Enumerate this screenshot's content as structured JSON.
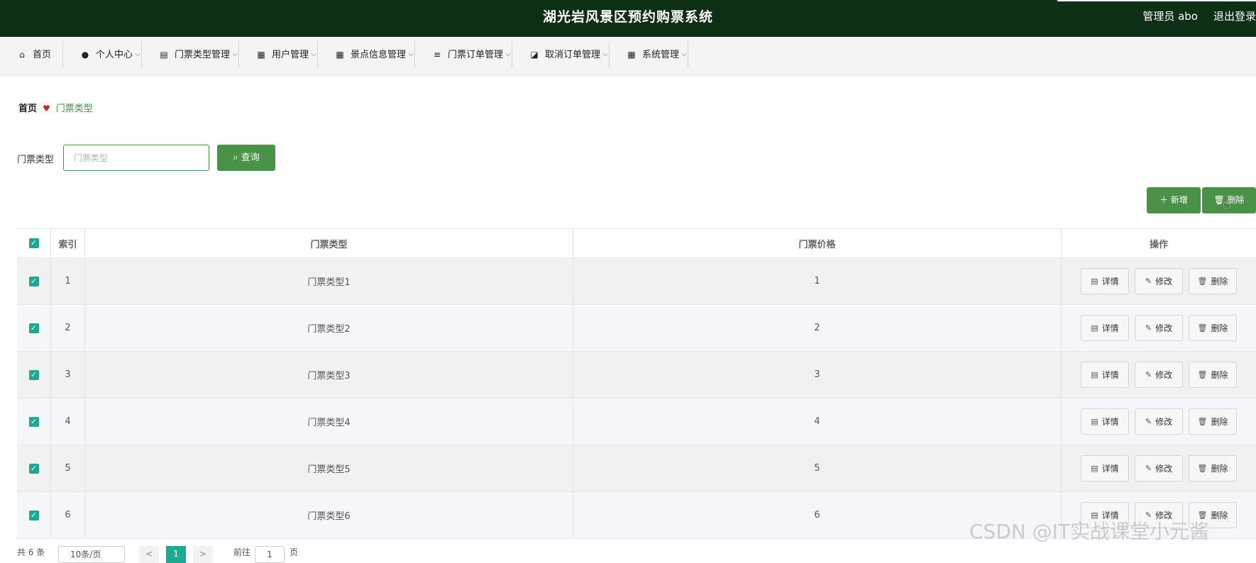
{
  "header": {
    "title": "湖光岩风景区预约购票系统",
    "user": "管理员 abo",
    "logout": "退出登录"
  },
  "nav": [
    {
      "label": "首页",
      "icon": "home-icon",
      "has_dropdown": false
    },
    {
      "label": "个人中心",
      "icon": "user-icon",
      "has_dropdown": true
    },
    {
      "label": "门票类型管理",
      "icon": "clipboard-icon",
      "has_dropdown": true
    },
    {
      "label": "用户管理",
      "icon": "grid-icon",
      "has_dropdown": true
    },
    {
      "label": "景点信息管理",
      "icon": "grid-icon",
      "has_dropdown": true
    },
    {
      "label": "门票订单管理",
      "icon": "list-icon",
      "has_dropdown": true
    },
    {
      "label": "取消订单管理",
      "icon": "chart-icon",
      "has_dropdown": true
    },
    {
      "label": "系统管理",
      "icon": "grid-icon",
      "has_dropdown": true
    }
  ],
  "breadcrumb": {
    "home": "首页",
    "current": "门票类型"
  },
  "search": {
    "label": "门票类型",
    "placeholder": "门票类型",
    "value": "",
    "button": "查询"
  },
  "actions": {
    "add": "新增",
    "delete": "删除"
  },
  "table": {
    "headers": {
      "index": "索引",
      "type": "门票类型",
      "price": "门票价格",
      "ops": "操作"
    },
    "rows": [
      {
        "index": "1",
        "type": "门票类型1",
        "price": "1",
        "checked": true
      },
      {
        "index": "2",
        "type": "门票类型2",
        "price": "2",
        "checked": true
      },
      {
        "index": "3",
        "type": "门票类型3",
        "price": "3",
        "checked": true
      },
      {
        "index": "4",
        "type": "门票类型4",
        "price": "4",
        "checked": true
      },
      {
        "index": "5",
        "type": "门票类型5",
        "price": "5",
        "checked": true
      },
      {
        "index": "6",
        "type": "门票类型6",
        "price": "6",
        "checked": true
      }
    ],
    "row_actions": {
      "detail": "详情",
      "edit": "修改",
      "delete": "删除"
    }
  },
  "pager": {
    "total": "共 6 条",
    "page_size": "10条/页",
    "prev": "<",
    "current": "1",
    "next": ">",
    "goto_label": "前往",
    "goto_value": "1",
    "page_suffix": "页"
  },
  "watermark": "CSDN @IT实战课堂小元酱",
  "colors": {
    "header_bg": "#0d2f14",
    "accent": "#4a9248",
    "checkbox": "#1fa88f"
  }
}
